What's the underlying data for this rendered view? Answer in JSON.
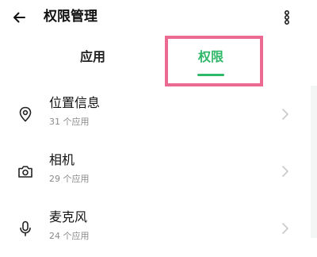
{
  "header": {
    "title": "权限管理",
    "back_icon": "arrow-left-icon",
    "more_icon": "more-vertical-icon"
  },
  "tabs": [
    {
      "label": "应用",
      "active": false
    },
    {
      "label": "权限",
      "active": true
    }
  ],
  "colors": {
    "accent": "#2fb868",
    "highlight": "#ea6a92",
    "secondary_text": "#8a8a8a",
    "chevron": "#c8c8c8"
  },
  "permissions": [
    {
      "icon": "location-pin-icon",
      "title": "位置信息",
      "subtitle": "31 个应用"
    },
    {
      "icon": "camera-icon",
      "title": "相机",
      "subtitle": "29 个应用"
    },
    {
      "icon": "microphone-icon",
      "title": "麦克风",
      "subtitle": "24 个应用"
    }
  ]
}
